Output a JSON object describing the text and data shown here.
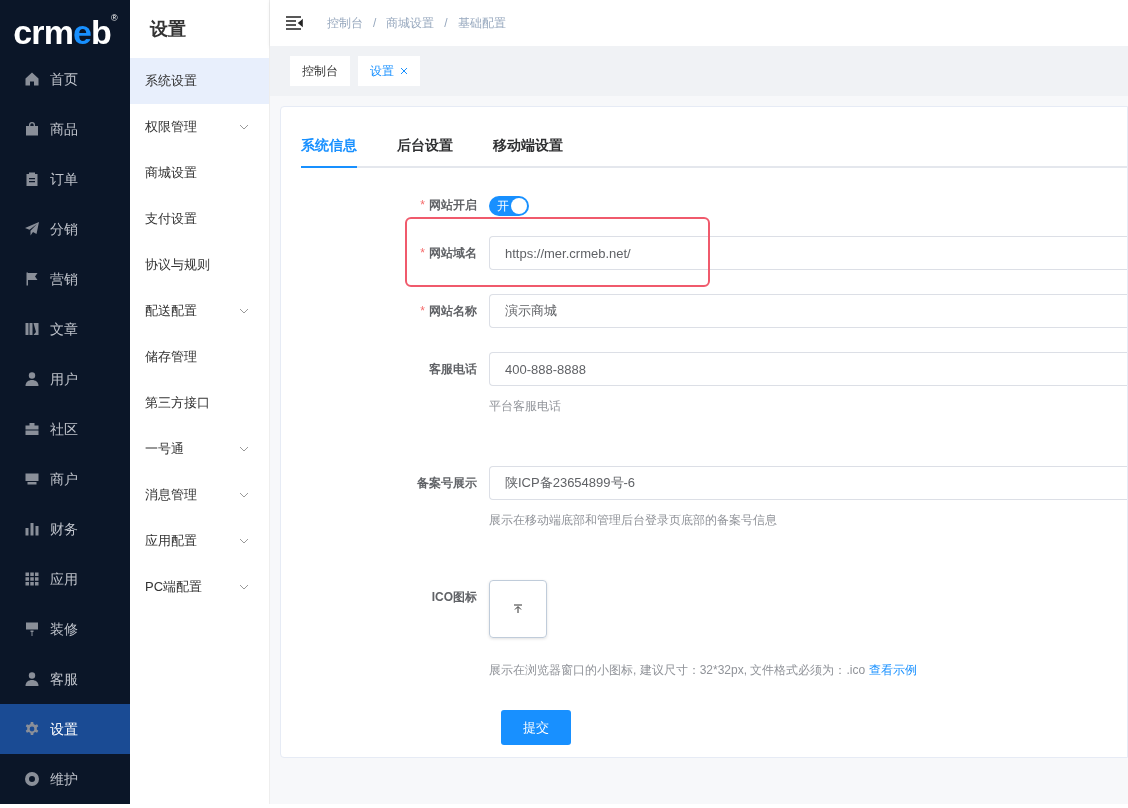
{
  "logo": {
    "prefix": "crm",
    "accent": "e",
    "suffix": "b",
    "mark": "®"
  },
  "main_menu": [
    {
      "label": "首页",
      "selected": false
    },
    {
      "label": "商品",
      "selected": false
    },
    {
      "label": "订单",
      "selected": false
    },
    {
      "label": "分销",
      "selected": false
    },
    {
      "label": "营销",
      "selected": false
    },
    {
      "label": "文章",
      "selected": false
    },
    {
      "label": "用户",
      "selected": false
    },
    {
      "label": "社区",
      "selected": false
    },
    {
      "label": "商户",
      "selected": false
    },
    {
      "label": "财务",
      "selected": false
    },
    {
      "label": "应用",
      "selected": false
    },
    {
      "label": "装修",
      "selected": false
    },
    {
      "label": "客服",
      "selected": false
    },
    {
      "label": "设置",
      "selected": true
    },
    {
      "label": "维护",
      "selected": false
    }
  ],
  "sub_menu": {
    "title": "设置",
    "items": [
      {
        "label": "系统设置",
        "selected": true,
        "has_children": false
      },
      {
        "label": "权限管理",
        "selected": false,
        "has_children": true
      },
      {
        "label": "商城设置",
        "selected": false,
        "has_children": false
      },
      {
        "label": "支付设置",
        "selected": false,
        "has_children": false
      },
      {
        "label": "协议与规则",
        "selected": false,
        "has_children": false
      },
      {
        "label": "配送配置",
        "selected": false,
        "has_children": true
      },
      {
        "label": "储存管理",
        "selected": false,
        "has_children": false
      },
      {
        "label": "第三方接口",
        "selected": false,
        "has_children": false
      },
      {
        "label": "一号通",
        "selected": false,
        "has_children": true
      },
      {
        "label": "消息管理",
        "selected": false,
        "has_children": true
      },
      {
        "label": "应用配置",
        "selected": false,
        "has_children": true
      },
      {
        "label": "PC端配置",
        "selected": false,
        "has_children": true
      }
    ]
  },
  "breadcrumb": [
    "控制台",
    "商城设置",
    "基础配置"
  ],
  "breadcrumb_separator": "/",
  "page_tags": [
    {
      "label": "控制台",
      "selected": false,
      "closable": false
    },
    {
      "label": "设置",
      "selected": true,
      "closable": true
    }
  ],
  "tabs": [
    {
      "label": "系统信息",
      "selected": true
    },
    {
      "label": "后台设置",
      "selected": false
    },
    {
      "label": "移动端设置",
      "selected": false
    }
  ],
  "form": [
    {
      "kind": "switch",
      "label": "网站开启",
      "required_mark": "*",
      "on": true,
      "switch_text": "开",
      "highlighted": false
    },
    {
      "kind": "input",
      "label": "网站域名",
      "required_mark": "*",
      "value": "https://mer.crmeb.net/",
      "highlighted": true
    },
    {
      "kind": "input",
      "label": "网站名称",
      "required_mark": "*",
      "value": "演示商城",
      "highlighted": false
    },
    {
      "kind": "input",
      "label": "客服电话",
      "value": "400-888-8888",
      "hint": "平台客服电话",
      "highlighted": false
    },
    {
      "kind": "input",
      "label": "备案号展示",
      "value": "陕ICP备23654899号-6",
      "hint": "展示在移动端底部和管理后台登录页底部的备案号信息",
      "highlighted": false
    },
    {
      "kind": "upload",
      "label": "ICO图标",
      "hint": "展示在浏览器窗口的小图标, 建议尺寸：32*32px, 文件格式必须为：.ico",
      "hint_link": "查看示例",
      "highlighted": false
    }
  ],
  "submit_button": "提交"
}
